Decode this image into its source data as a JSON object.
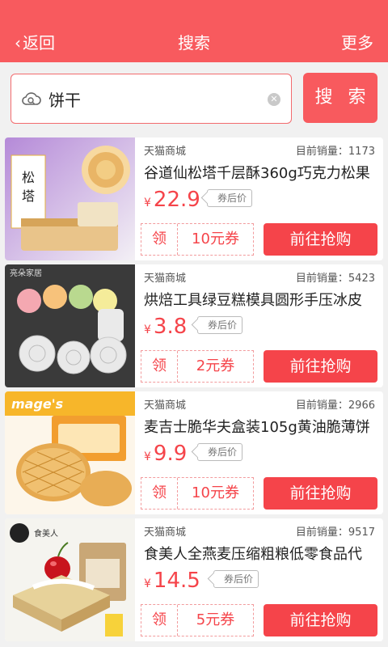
{
  "header": {
    "back_label": "返回",
    "title": "搜索",
    "more_label": "更多"
  },
  "search": {
    "query": "饼干",
    "button_label": "搜 索"
  },
  "colors": {
    "brand_red": "#f85a5e",
    "price_red": "#f5444a"
  },
  "products": [
    {
      "shop": "天猫商城",
      "sales": "目前销量：1173",
      "name": "谷道仙松塔千层酥360g巧克力松果",
      "currency": "¥",
      "price": "22.9",
      "price_note": "券后价",
      "coupon_claim": "领",
      "coupon_amount": "10元券",
      "buy_label": "前往抢购",
      "image_text": "松塔"
    },
    {
      "shop": "天猫商城",
      "sales": "目前销量：5423",
      "name": "烘焙工具绿豆糕模具圆形手压冰皮",
      "currency": "¥",
      "price": "3.8",
      "price_note": "券后价",
      "coupon_claim": "领",
      "coupon_amount": "2元券",
      "buy_label": "前往抢购",
      "image_text": "亮朵家居"
    },
    {
      "shop": "天猫商城",
      "sales": "目前销量：2966",
      "name": "麦吉士脆华夫盒装105g黄油脆薄饼",
      "currency": "¥",
      "price": "9.9",
      "price_note": "券后价",
      "coupon_claim": "领",
      "coupon_amount": "10元券",
      "buy_label": "前往抢购",
      "image_text": "mage's"
    },
    {
      "shop": "天猫商城",
      "sales": "目前销量：9517",
      "name": "食美人全燕麦压缩粗粮低零食品代",
      "currency": "¥",
      "price": "14.5",
      "price_note": "券后价",
      "coupon_claim": "领",
      "coupon_amount": "5元券",
      "buy_label": "前往抢购",
      "image_text": "食美人"
    }
  ]
}
